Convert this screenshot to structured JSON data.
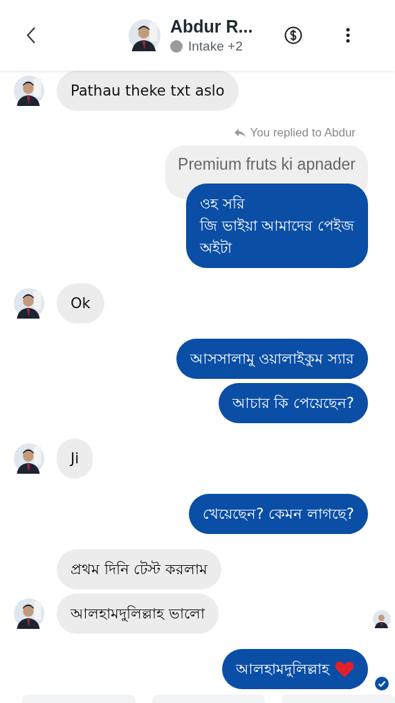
{
  "header": {
    "title": "Abdur R...",
    "status": "Intake +2"
  },
  "messages": [
    {
      "kind": "incoming",
      "text": "Pathau theke txt aslo",
      "avatar": true
    },
    {
      "kind": "outgoing",
      "reply_label": "You replied to Abdur",
      "quoted": "Premium fruts ki apnader",
      "text": "ওহ সরি\nজি ভাইয়া আমাদের পেইজ\nঅইটা"
    },
    {
      "kind": "incoming",
      "text": "Ok",
      "avatar": true
    },
    {
      "kind": "outgoing",
      "text": "আসসালামু ওয়ালাইকুম স্যার"
    },
    {
      "kind": "outgoing",
      "text": "আচার কি পেয়েছেন?"
    },
    {
      "kind": "incoming",
      "text": "Ji",
      "avatar": true
    },
    {
      "kind": "outgoing",
      "text": "খেয়েছেন?  কেমন লাগছে?"
    },
    {
      "kind": "incoming",
      "text": "প্রথম দিনি টেস্ট করলাম",
      "avatar": false
    },
    {
      "kind": "incoming",
      "text": "আলহামদুলিল্লাহ ভালো",
      "avatar": true,
      "seen": true
    },
    {
      "kind": "outgoing",
      "text": "আলহামদুলিল্লাহ",
      "heart": true,
      "delivered": true
    }
  ]
}
